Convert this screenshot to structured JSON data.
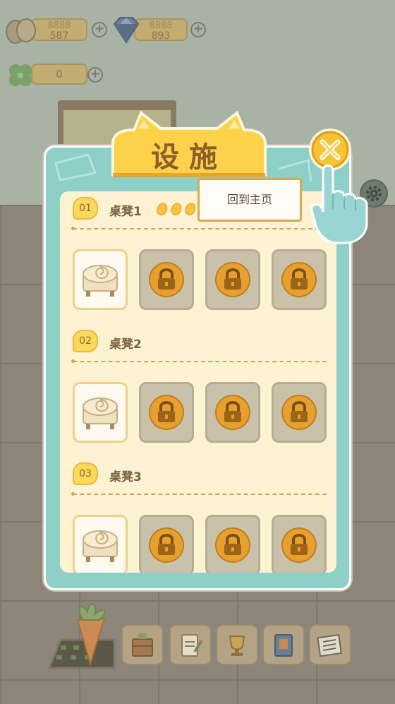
{
  "resources": {
    "eggs": {
      "ghost": "8888",
      "value": "587",
      "icon": "egg-icon"
    },
    "gems": {
      "ghost": "8888",
      "value": "893",
      "icon": "gem-icon"
    },
    "clover": {
      "value": "0",
      "icon": "clover-icon"
    },
    "plus_label": "+"
  },
  "panel": {
    "title": "设施",
    "close_icon": "close-icon",
    "tooltip": "回到主页",
    "sections": [
      {
        "badge": "01",
        "name": "桌凳1",
        "seeds": 3
      },
      {
        "badge": "02",
        "name": "桌凳2",
        "seeds": 0
      },
      {
        "badge": "03",
        "name": "桌凳3",
        "seeds": 0
      }
    ]
  },
  "toolbar": [
    "carrot-icon",
    "cabinet-icon",
    "clipboard-icon",
    "trophy-icon",
    "book-icon",
    "newspaper-icon"
  ],
  "colors": {
    "panel": "#8ed0c8",
    "panel_inner": "#fdf3d2",
    "accent": "#f5c434",
    "lock": "#e7a030"
  }
}
